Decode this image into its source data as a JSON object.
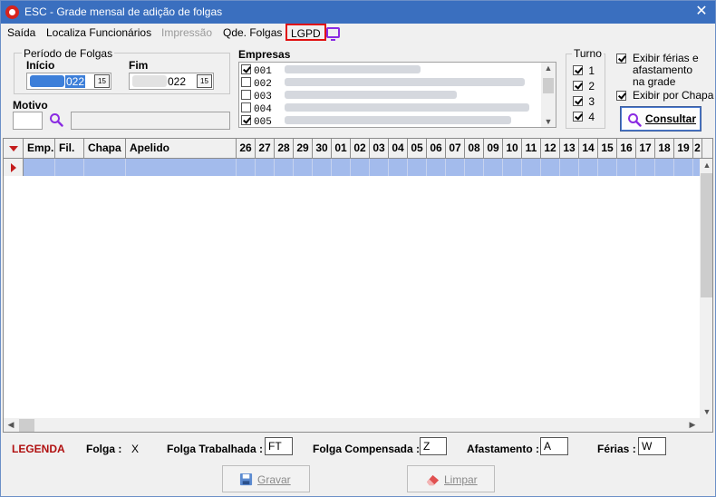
{
  "window": {
    "title": "ESC - Grade mensal de adição de folgas",
    "close_label": "✕"
  },
  "menu": [
    {
      "label": "Saída"
    },
    {
      "label": "Localiza Funcionários"
    },
    {
      "label": "Impressão"
    },
    {
      "label": "Qde. Folgas"
    },
    {
      "label": "LGPD"
    }
  ],
  "periodo": {
    "group_label": "Período de Folgas",
    "inicio_label": "Início",
    "inicio_value": "022",
    "fim_label": "Fim",
    "fim_value": "022",
    "calendar_label": "15"
  },
  "motivo": {
    "label": "Motivo",
    "code_value": "",
    "description_value": ""
  },
  "empresas": {
    "label": "Empresas",
    "items": [
      {
        "code": "001",
        "checked": true
      },
      {
        "code": "002",
        "checked": false
      },
      {
        "code": "003",
        "checked": false
      },
      {
        "code": "004",
        "checked": false
      },
      {
        "code": "005",
        "checked": true
      }
    ]
  },
  "turno": {
    "label": "Turno",
    "items": [
      {
        "label": "1",
        "checked": true
      },
      {
        "label": "2",
        "checked": true
      },
      {
        "label": "3",
        "checked": true
      },
      {
        "label": "4",
        "checked": true
      }
    ]
  },
  "options": {
    "exibir_ferias": {
      "label": "Exibir férias e afastamento na grade",
      "checked": true
    },
    "exibir_chapa": {
      "label": "Exibir por Chapa",
      "checked": true
    }
  },
  "consultar_label": "Consultar",
  "grid": {
    "columns": [
      "Emp.",
      "Fil.",
      "Chapa",
      "Apelido",
      "26",
      "27",
      "28",
      "29",
      "30",
      "01",
      "02",
      "03",
      "04",
      "05",
      "06",
      "07",
      "08",
      "09",
      "10",
      "11",
      "12",
      "13",
      "14",
      "15",
      "16",
      "17",
      "18",
      "19",
      "2"
    ]
  },
  "legenda": {
    "title": "LEGENDA",
    "folga_label": "Folga :",
    "folga_value": "X",
    "folga_trabalhada_label": "Folga Trabalhada :",
    "folga_trabalhada_value": "FT",
    "folga_compensada_label": "Folga Compensada :",
    "folga_compensada_value": "Z",
    "afastamento_label": "Afastamento :",
    "afastamento_value": "A",
    "ferias_label": "Férias :",
    "ferias_value": "W"
  },
  "buttons": {
    "gravar": "Gravar",
    "limpar": "Limpar"
  },
  "colors": {
    "titlebar": "#3a6fbf",
    "selected_row": "#a3bbec",
    "legend_title": "#b01010",
    "highlight_box": "#e01010",
    "accent_purple": "#8a2be2"
  }
}
